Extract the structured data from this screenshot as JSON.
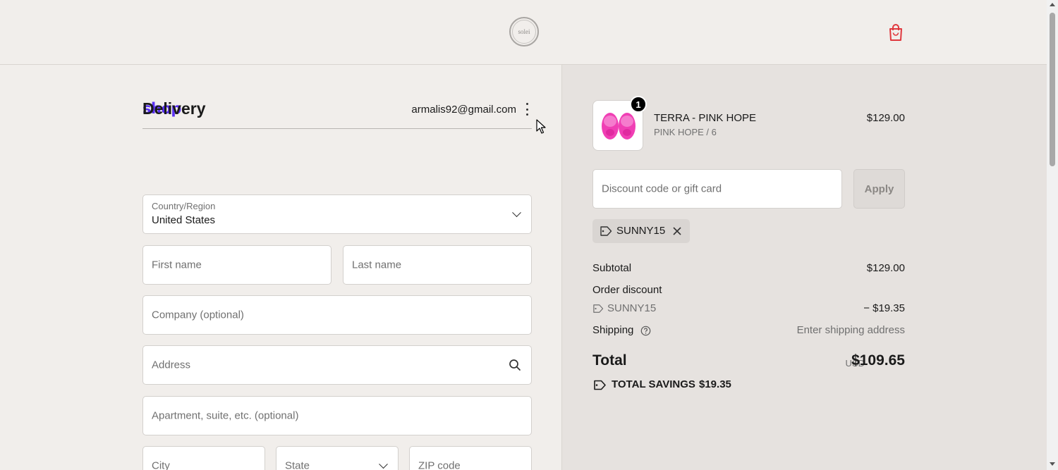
{
  "header": {
    "logo_text": "solei",
    "cart_icon": "shopping-bag-icon"
  },
  "account": {
    "shop_logo": "shop",
    "email": "armalis92@gmail.com",
    "menu_icon": "more-vertical-icon"
  },
  "delivery": {
    "title": "Delivery",
    "country_label": "Country/Region",
    "country_value": "United States",
    "first_name_placeholder": "First name",
    "last_name_placeholder": "Last name",
    "company_placeholder": "Company (optional)",
    "address_placeholder": "Address",
    "apartment_placeholder": "Apartment, suite, etc. (optional)",
    "city_placeholder": "City",
    "state_placeholder": "State",
    "zip_placeholder": "ZIP code"
  },
  "summary": {
    "product": {
      "name": "TERRA - PINK HOPE",
      "variant": "PINK HOPE / 6",
      "price": "$129.00",
      "quantity": "1",
      "image_color": "#f03fb4"
    },
    "discount_placeholder": "Discount code or gift card",
    "apply_label": "Apply",
    "applied_code": "SUNNY15",
    "subtotal_label": "Subtotal",
    "subtotal_value": "$129.00",
    "order_discount_label": "Order discount",
    "discount_code": "SUNNY15",
    "discount_value": "− $19.35",
    "shipping_label": "Shipping",
    "shipping_value": "Enter shipping address",
    "total_label": "Total",
    "total_currency": "USD",
    "total_value": "$109.65",
    "savings_label": "TOTAL SAVINGS",
    "savings_value": "$19.35"
  },
  "colors": {
    "shop_brand": "#5a31f4",
    "cart_accent": "#e0383e",
    "left_bg": "#f1eeeb",
    "right_bg": "#e6e2df"
  }
}
